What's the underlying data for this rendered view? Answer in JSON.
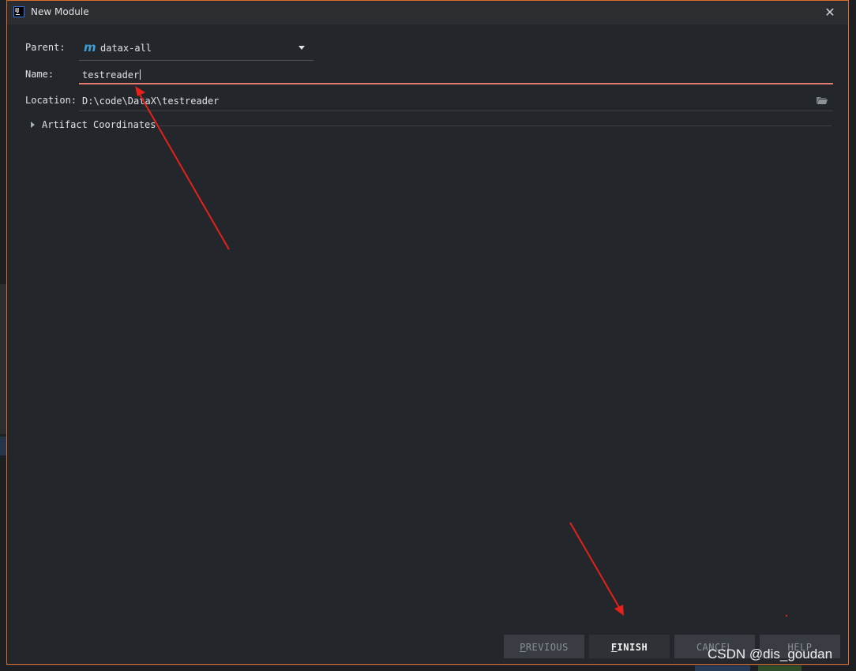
{
  "window": {
    "title": "New Module",
    "app_icon_text": "IJ"
  },
  "form": {
    "parent_label": "Parent:",
    "parent_value": "datax-all",
    "parent_icon_text": "m",
    "name_label": "Name:",
    "name_value": "testreader",
    "location_label": "Location:",
    "location_value": "D:\\code\\DataX\\testreader",
    "artifact_label": "Artifact Coordinates"
  },
  "buttons": {
    "previous_mnemonic": "P",
    "previous_rest": "REVIOUS",
    "finish_mnemonic": "F",
    "finish_rest": "INISH",
    "cancel_label": "CANCEL",
    "help_label": "HELP"
  },
  "watermark": "CSDN @dis_goudan",
  "colors": {
    "dialog_bg": "#23272b",
    "border_accent": "#d96c2b",
    "name_underline": "#e07d6e",
    "annotation_arrow": "#e8201a"
  }
}
